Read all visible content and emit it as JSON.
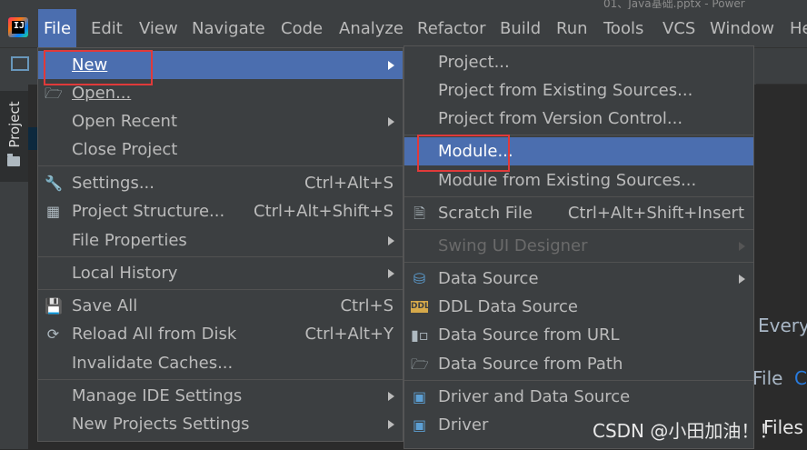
{
  "window": {
    "title": "01、Java基础.pptx - Power"
  },
  "menubar": {
    "items": [
      "File",
      "Edit",
      "View",
      "Navigate",
      "Code",
      "Analyze",
      "Refactor",
      "Build",
      "Run",
      "Tools",
      "VCS",
      "Window",
      "He"
    ],
    "active": "File"
  },
  "sidebar": {
    "tab": "Project"
  },
  "file_menu": {
    "items": [
      {
        "label": "New",
        "submenu": true,
        "selected": true
      },
      {
        "label": "Open...",
        "icon": "folder-open-icon"
      },
      {
        "label": "Open Recent",
        "submenu": true
      },
      {
        "label": "Close Project"
      },
      {
        "label": "Settings...",
        "shortcut": "Ctrl+Alt+S",
        "icon": "wrench-icon"
      },
      {
        "label": "Project Structure...",
        "shortcut": "Ctrl+Alt+Shift+S",
        "icon": "project-structure-icon"
      },
      {
        "label": "File Properties",
        "submenu": true
      },
      {
        "label": "Local History",
        "submenu": true
      },
      {
        "label": "Save All",
        "shortcut": "Ctrl+S",
        "icon": "save-icon"
      },
      {
        "label": "Reload All from Disk",
        "shortcut": "Ctrl+Alt+Y",
        "icon": "reload-icon"
      },
      {
        "label": "Invalidate Caches..."
      },
      {
        "label": "Manage IDE Settings",
        "submenu": true
      },
      {
        "label": "New Projects Settings",
        "submenu": true
      }
    ]
  },
  "new_submenu": {
    "items": [
      {
        "label": "Project..."
      },
      {
        "label": "Project from Existing Sources..."
      },
      {
        "label": "Project from Version Control..."
      },
      {
        "label": "Module...",
        "selected": true
      },
      {
        "label": "Module from Existing Sources..."
      },
      {
        "label": "Scratch File",
        "shortcut": "Ctrl+Alt+Shift+Insert",
        "icon": "scratch-file-icon"
      },
      {
        "label": "Swing UI Designer",
        "submenu": true,
        "disabled": true
      },
      {
        "label": "Data Source",
        "submenu": true,
        "icon": "database-icon"
      },
      {
        "label": "DDL Data Source",
        "icon": "ddl-icon"
      },
      {
        "label": "Data Source from URL",
        "icon": "url-icon"
      },
      {
        "label": "Data Source from Path",
        "icon": "folder-icon"
      },
      {
        "label": "Driver and Data Source",
        "icon": "driver-icon"
      },
      {
        "label": "Driver",
        "icon": "driver-icon"
      }
    ]
  },
  "editor": {
    "line1": "Every",
    "line2_word": "File",
    "line2_extra": "C"
  },
  "watermark": "CSDN @小田加油！！",
  "trailing_text": "Files",
  "colors": {
    "selection": "#4b6eaf",
    "menu_bg": "#3c3f41",
    "highlight_box": "#e03a3a"
  }
}
